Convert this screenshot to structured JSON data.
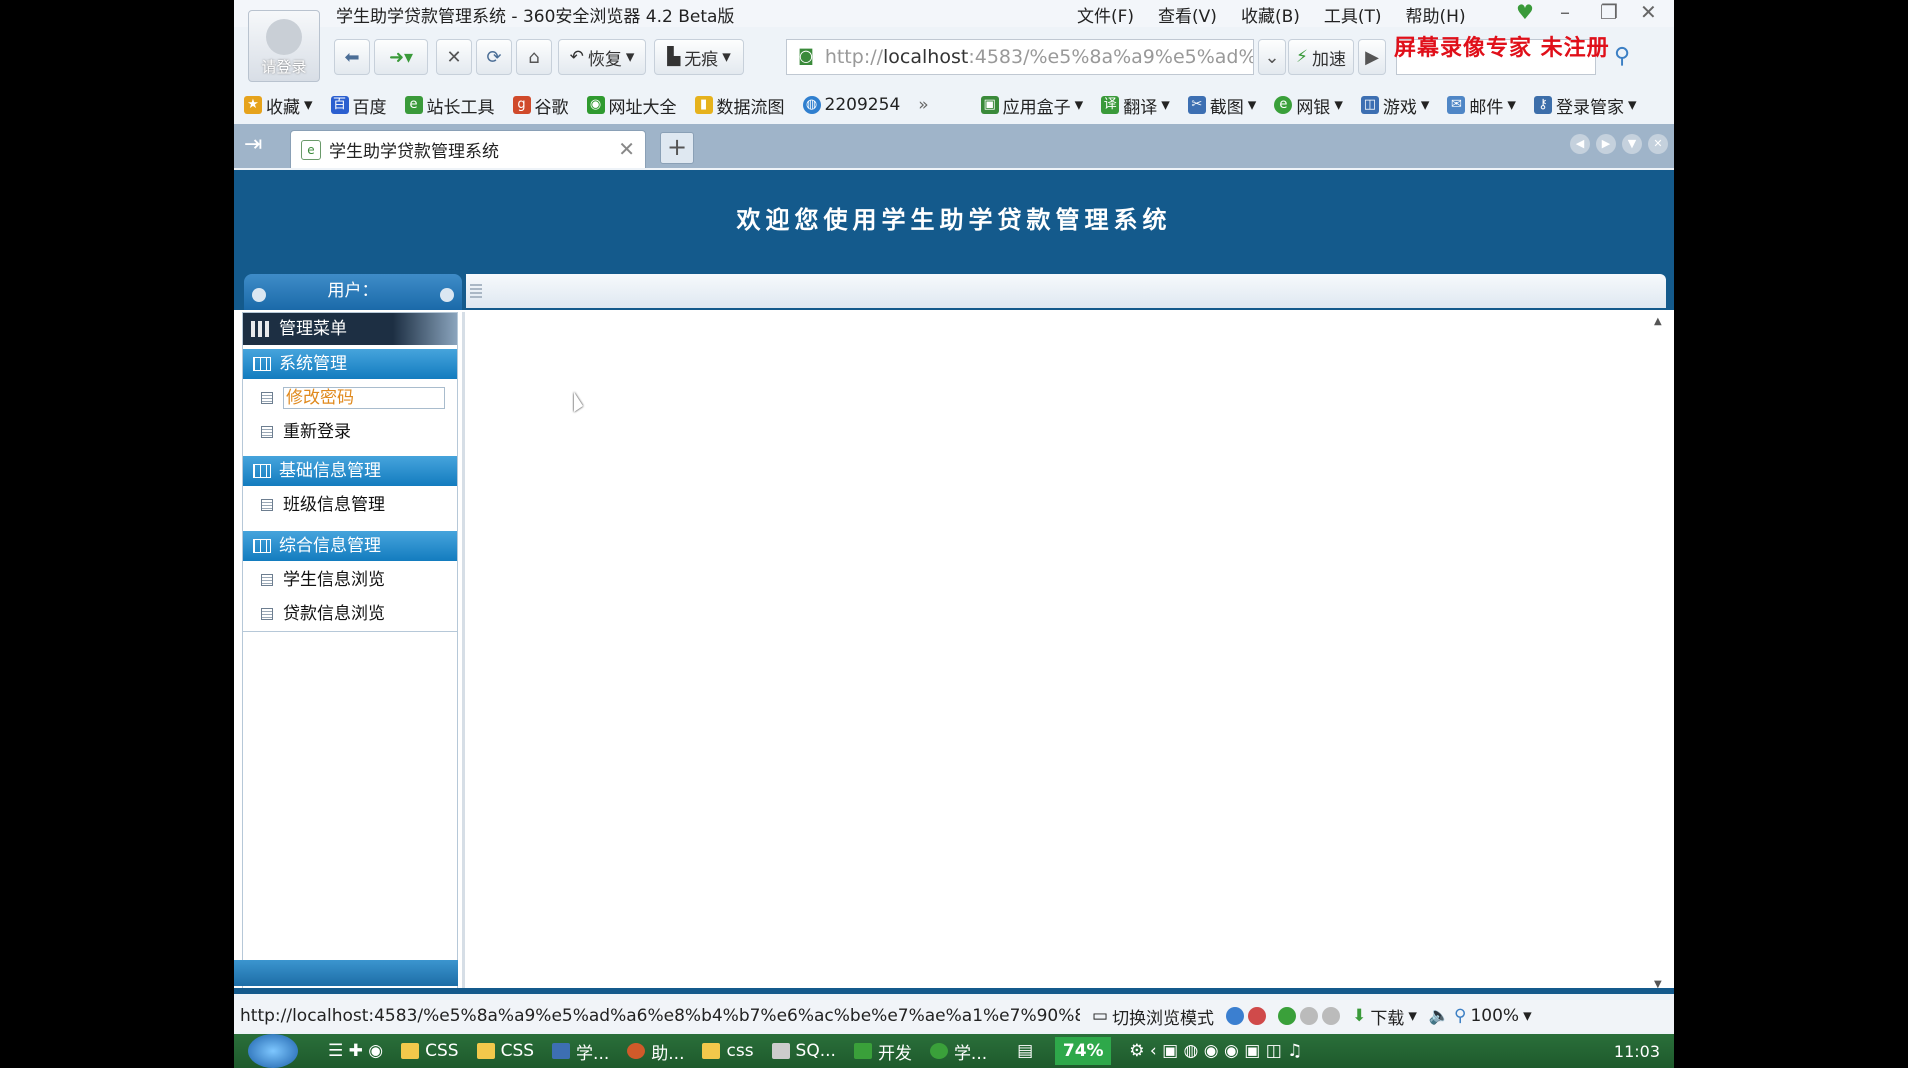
{
  "window": {
    "title": "学生助学贷款管理系统 - 360安全浏览器 4.2 Beta版",
    "menu": [
      "文件(F)",
      "查看(V)",
      "收藏(B)",
      "工具(T)",
      "帮助(H)"
    ],
    "login_label": "请登录"
  },
  "toolbar": {
    "restore": "恢复",
    "incognito": "无痕",
    "url_prefix": "http://",
    "url_host": "localhost",
    "url_rest": ":4583/%e5%8a%a9%e5%ad%",
    "accelerate": "加速",
    "watermark": "屏幕录像专家 未注册"
  },
  "favorites": [
    {
      "label": "收藏",
      "color": "#e6a31c"
    },
    {
      "label": "百度",
      "color": "#2b5fd0"
    },
    {
      "label": "站长工具",
      "color": "#3a9a3a"
    },
    {
      "label": "谷歌",
      "color": "#d04a2b"
    },
    {
      "label": "网址大全",
      "color": "#2f9a2f"
    },
    {
      "label": "数据流图",
      "color": "#e6b21c"
    },
    {
      "label": "2209254",
      "color": "#2f7fcf"
    }
  ],
  "favorites_right": [
    {
      "label": "应用盒子",
      "color": "#3a8a3a"
    },
    {
      "label": "翻译",
      "color": "#3a9a3a"
    },
    {
      "label": "截图",
      "color": "#3d6fb2"
    },
    {
      "label": "网银",
      "color": "#3aa03a"
    },
    {
      "label": "游戏",
      "color": "#3d6fb2"
    },
    {
      "label": "邮件",
      "color": "#4f86c6"
    },
    {
      "label": "登录管家",
      "color": "#3c6eaa"
    }
  ],
  "tab": {
    "label": "学生助学贷款管理系统"
  },
  "page": {
    "banner_title": "欢迎您使用学生助学贷款管理系统",
    "user_label": "用户：",
    "menu_header": "管理菜单",
    "groups": [
      {
        "label": "系统管理",
        "items": [
          "修改密码",
          "重新登录"
        ]
      },
      {
        "label": "基础信息管理",
        "items": [
          "班级信息管理"
        ]
      },
      {
        "label": "综合信息管理",
        "items": [
          "学生信息浏览",
          "贷款信息浏览"
        ]
      }
    ],
    "brand_color": "#145a8c"
  },
  "status": {
    "url": "http://localhost:4583/%e5%8a%a9%e5%ad%a6%e8%b4%b7%e6%ac%be%e7%ae%a1%e7%90%86...",
    "mode": "切换浏览模式",
    "download": "下载",
    "zoom": "100%"
  },
  "taskbar": {
    "items": [
      "CSS",
      "CSS",
      "学...",
      "助...",
      "css",
      "SQ...",
      "开发",
      "学..."
    ],
    "battery": "74%",
    "time": "11:03"
  }
}
